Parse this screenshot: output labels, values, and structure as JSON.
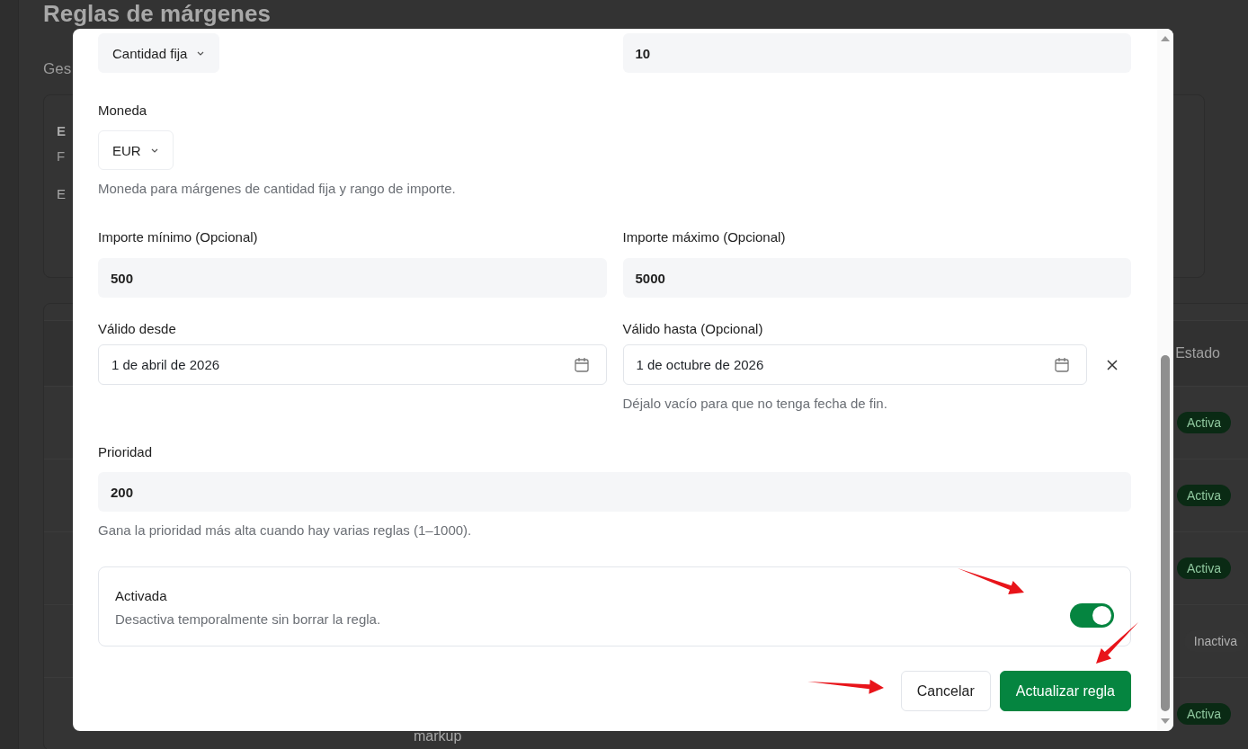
{
  "page": {
    "title": "Reglas de márgenes",
    "subtitle": "Ges",
    "card_lines": [
      "E",
      "F",
      "E"
    ],
    "table": {
      "status_header": "Estado",
      "rows": [
        {
          "status": "Activa",
          "active": true
        },
        {
          "status": "Activa",
          "active": true
        },
        {
          "status": "Activa",
          "active": true
        },
        {
          "status": "Inactiva",
          "active": false
        },
        {
          "status": "Activa",
          "active": true,
          "cell": "markup"
        }
      ]
    }
  },
  "dialog": {
    "type_select": {
      "value": "Cantidad fija"
    },
    "amount_input": {
      "value": "10"
    },
    "currency": {
      "label": "Moneda",
      "value": "EUR",
      "hint": "Moneda para márgenes de cantidad fija y rango de importe."
    },
    "min_amount": {
      "label": "Importe mínimo (Opcional)",
      "value": "500"
    },
    "max_amount": {
      "label": "Importe máximo (Opcional)",
      "value": "5000"
    },
    "valid_from": {
      "label": "Válido desde",
      "value": "1 de abril de 2026"
    },
    "valid_to": {
      "label": "Válido hasta (Opcional)",
      "value": "1 de octubre de 2026",
      "hint": "Déjalo vacío para que no tenga fecha de fin."
    },
    "priority": {
      "label": "Prioridad",
      "value": "200",
      "hint": "Gana la prioridad más alta cuando hay varias reglas (1–1000)."
    },
    "enabled": {
      "title": "Activada",
      "description": "Desactiva temporalmente sin borrar la regla.",
      "on": true
    },
    "buttons": [
      {
        "label": "Cancelar",
        "kind": "secondary"
      },
      {
        "label": "Actualizar regla",
        "kind": "primary"
      }
    ]
  }
}
